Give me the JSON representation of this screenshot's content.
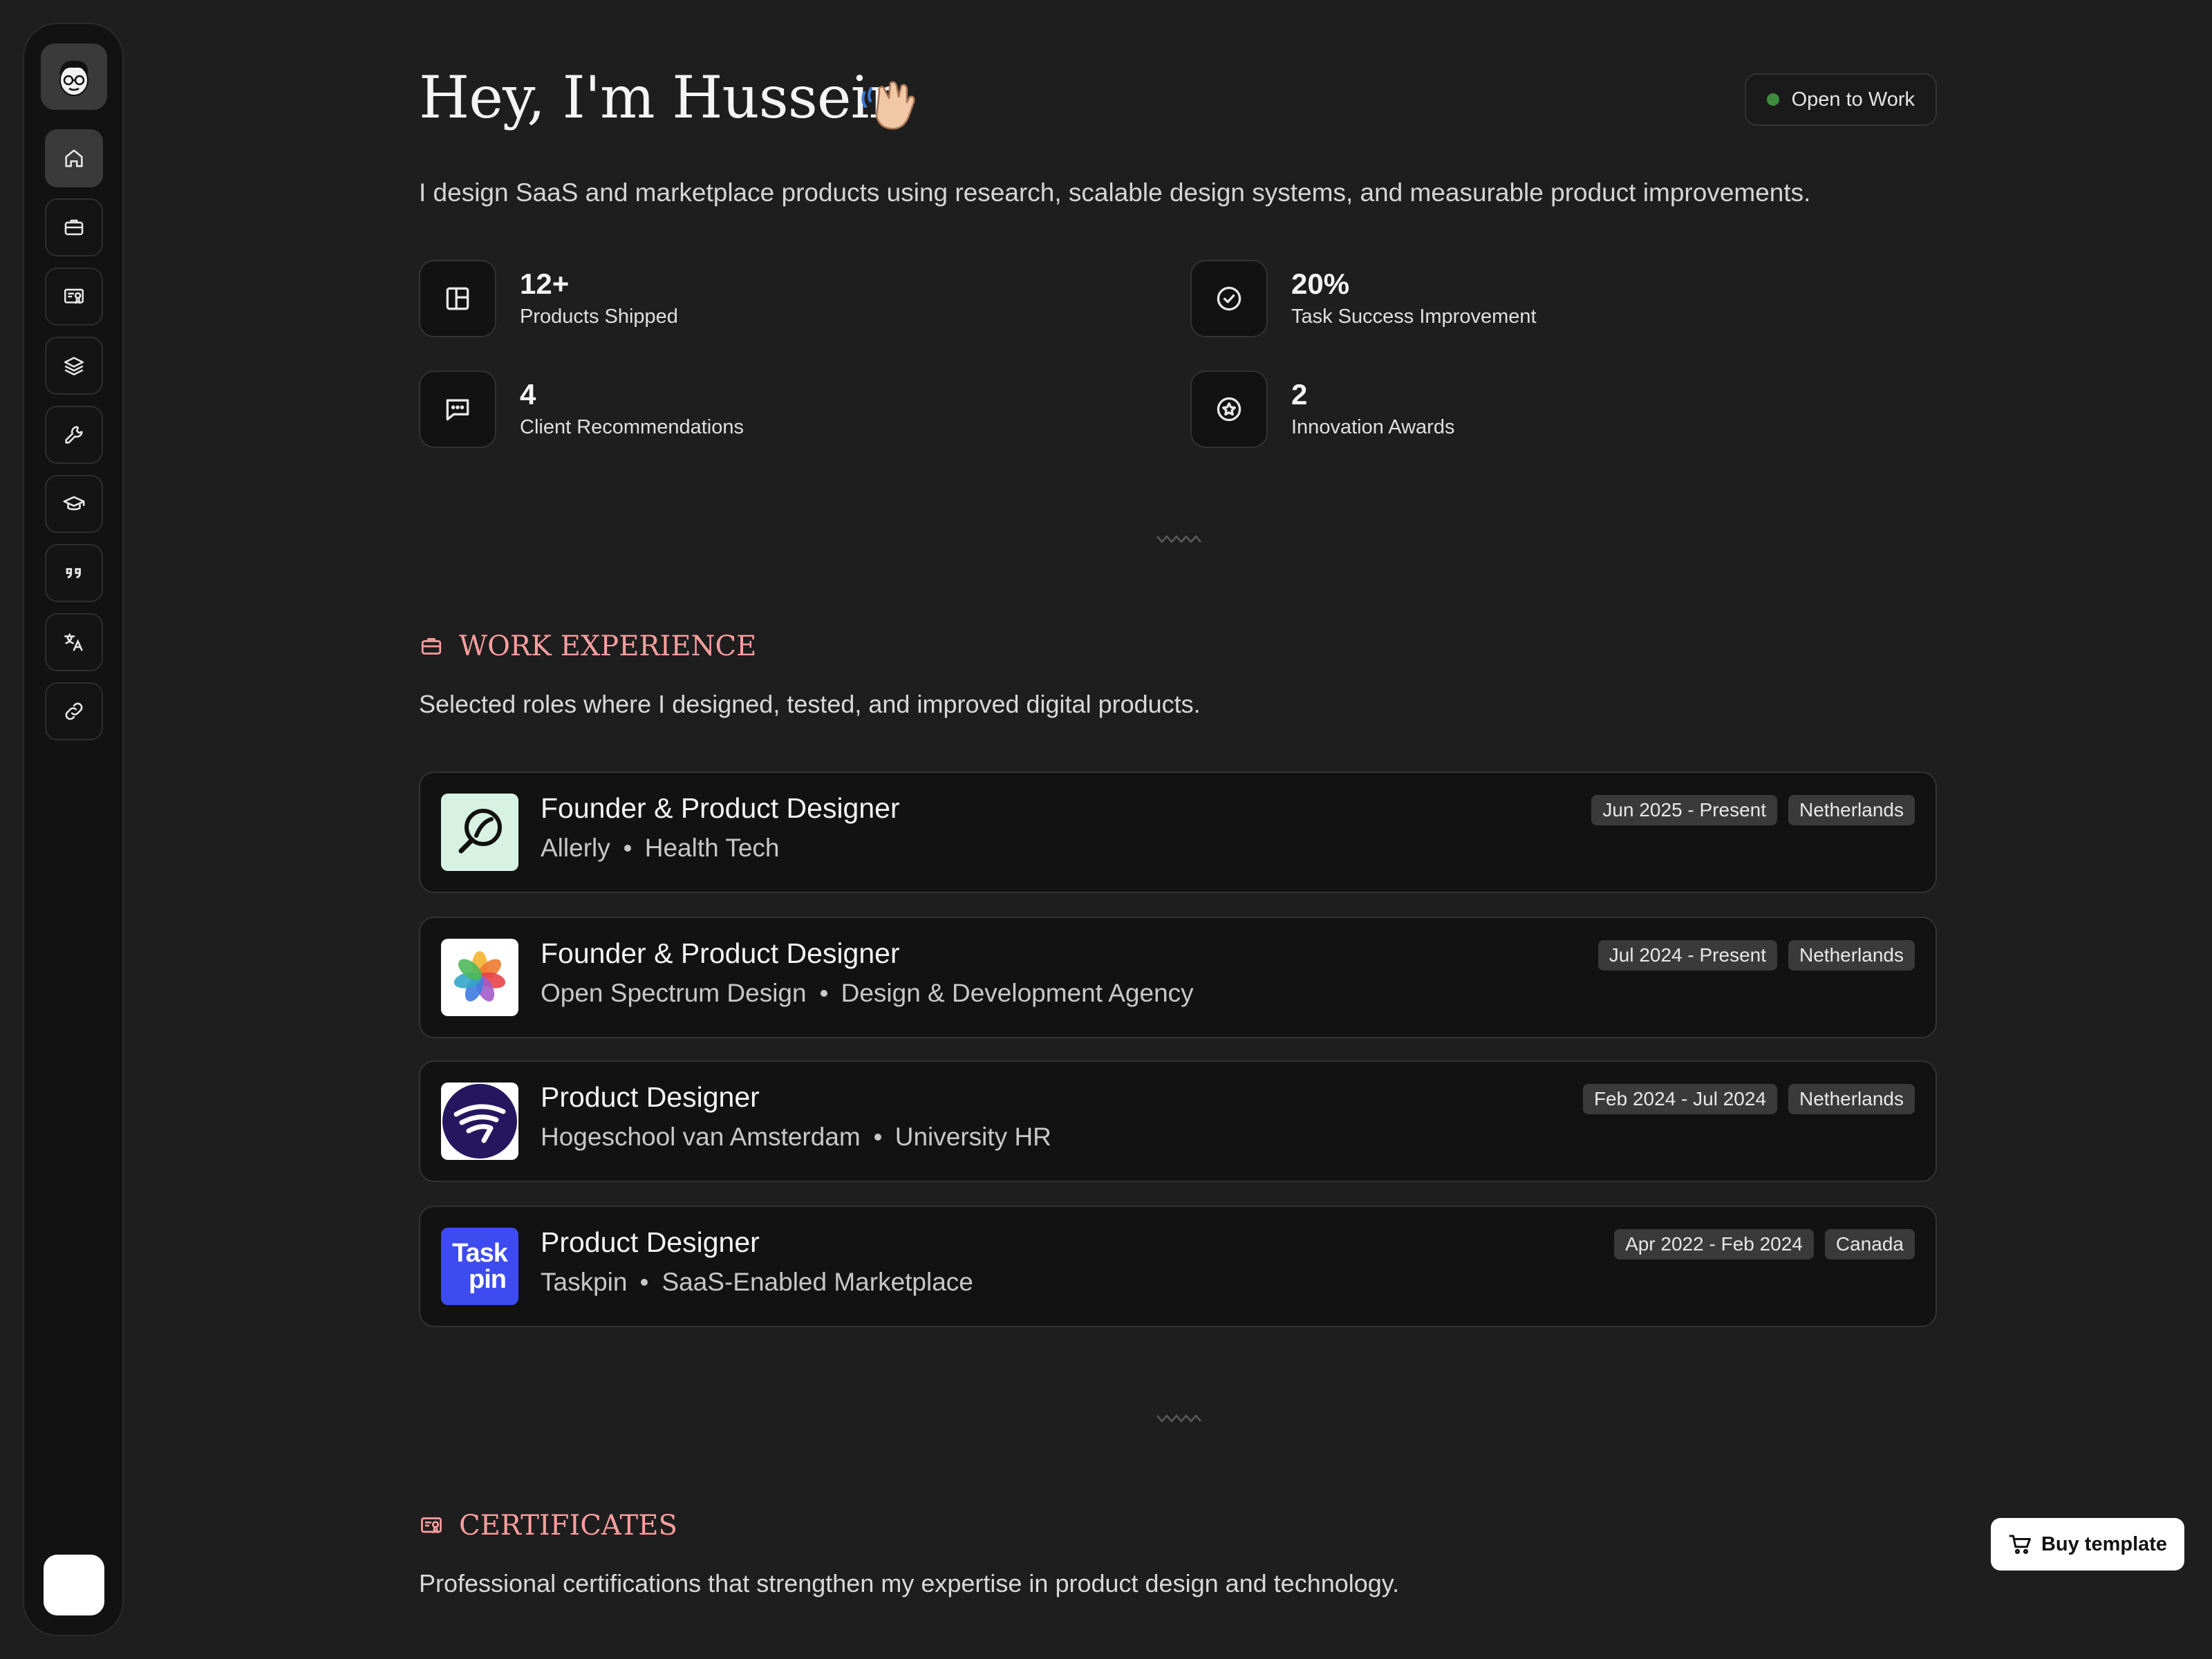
{
  "sidebar": {
    "avatar_icon": "avatar-illustration",
    "items": [
      {
        "name": "home",
        "icon": "home-icon",
        "active": true
      },
      {
        "name": "work",
        "icon": "briefcase-icon"
      },
      {
        "name": "certificates",
        "icon": "certificate-icon"
      },
      {
        "name": "projects",
        "icon": "layers-icon"
      },
      {
        "name": "tools",
        "icon": "wrench-icon"
      },
      {
        "name": "education",
        "icon": "graduation-cap-icon"
      },
      {
        "name": "recommendations",
        "icon": "quote-icon"
      },
      {
        "name": "languages",
        "icon": "translate-icon"
      },
      {
        "name": "links",
        "icon": "link-icon"
      }
    ],
    "theme_toggle": "theme-toggle"
  },
  "hero": {
    "title": "Hey, I'm Hussein",
    "wave_icon": "waving-hand-icon",
    "status_label": "Open to Work",
    "status_color": "#3e8b3e",
    "intro": "I design SaaS and marketplace products using research, scalable design systems, and measurable product improvements."
  },
  "stats": [
    {
      "value": "12+",
      "label": "Products Shipped",
      "icon": "layout-icon"
    },
    {
      "value": "20%",
      "label": "Task Success Improvement",
      "icon": "check-circle-icon"
    },
    {
      "value": "4",
      "label": "Client Recommendations",
      "icon": "message-icon"
    },
    {
      "value": "2",
      "label": "Innovation Awards",
      "icon": "star-badge-icon"
    }
  ],
  "work": {
    "title": "WORK EXPERIENCE",
    "description": "Selected roles where I designed, tested, and improved digital products.",
    "accent": "#ff9fa0",
    "jobs": [
      {
        "title": "Founder & Product Designer",
        "company": "Allerly",
        "industry": "Health Tech",
        "dates": "Jun 2025 - Present",
        "location": "Netherlands",
        "logo": "allerly-logo"
      },
      {
        "title": "Founder & Product Designer",
        "company": "Open Spectrum Design",
        "industry": "Design & Development Agency",
        "dates": "Jul 2024 - Present",
        "location": "Netherlands",
        "logo": "open-spectrum-logo"
      },
      {
        "title": "Product Designer",
        "company": "Hogeschool van Amsterdam",
        "industry": "University HR",
        "dates": "Feb 2024 - Jul 2024",
        "location": "Netherlands",
        "logo": "hva-logo"
      },
      {
        "title": "Product Designer",
        "company": "Taskpin",
        "industry": "SaaS-Enabled Marketplace",
        "dates": "Apr 2022 - Feb 2024",
        "location": "Canada",
        "logo": "taskpin-logo",
        "logo_text_1": "Task",
        "logo_text_2": "pin"
      }
    ]
  },
  "certificates": {
    "title": "CERTIFICATES",
    "description": "Professional certifications that strengthen my expertise in product design and technology."
  },
  "buy_button": {
    "label": "Buy template",
    "icon": "cart-icon"
  }
}
